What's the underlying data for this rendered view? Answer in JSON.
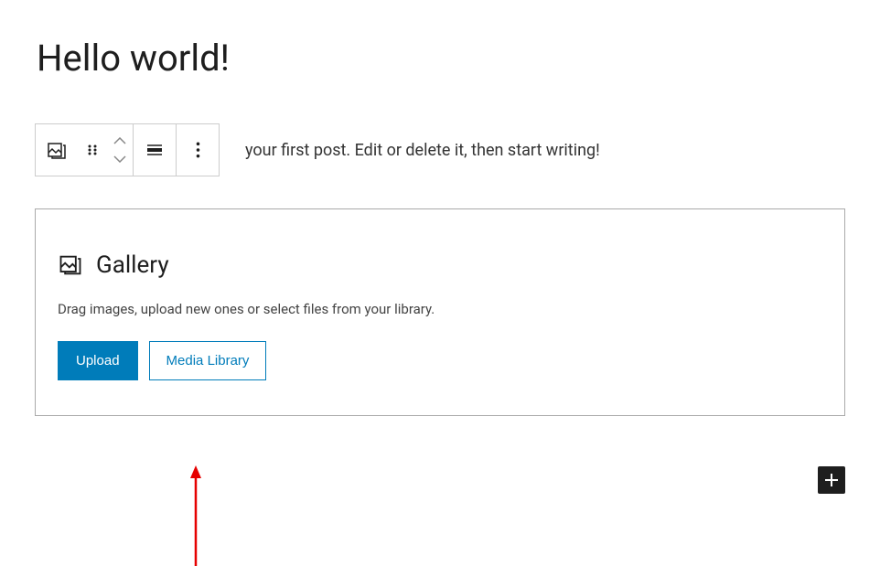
{
  "title": "Hello world!",
  "paragraph": "your first post. Edit or delete it, then start writing!",
  "toolbar": {
    "block_type": "gallery",
    "drag_handle": "drag",
    "move_up": "up",
    "move_down": "down",
    "align": "align",
    "more": "more"
  },
  "gallery": {
    "label": "Gallery",
    "description": "Drag images, upload new ones or select files from your library.",
    "upload_label": "Upload",
    "media_library_label": "Media Library"
  },
  "add_block": "+",
  "annotation": {
    "color": "#e60000",
    "target": "media-library-button"
  }
}
